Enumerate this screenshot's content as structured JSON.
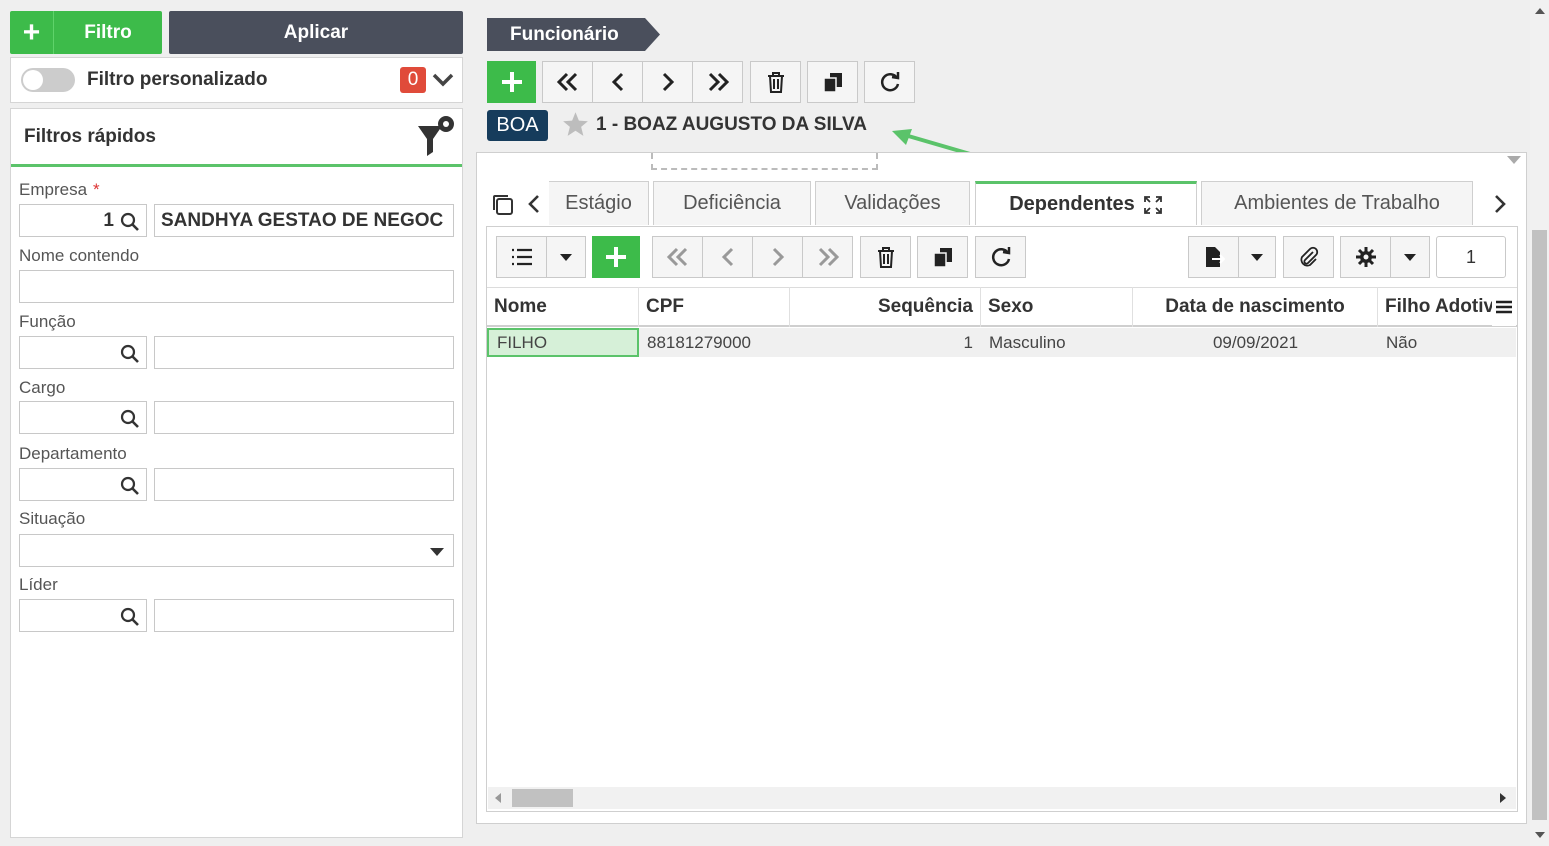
{
  "left": {
    "filtro_label": "Filtro",
    "aplicar_label": "Aplicar",
    "custom_filter_label": "Filtro personalizado",
    "custom_filter_count": "0",
    "quick_filters_title": "Filtros rápidos",
    "empresa": {
      "label": "Empresa",
      "required_mark": "*",
      "code": "1",
      "name": "SANDHYA GESTAO DE NEGOC"
    },
    "nome_contendo": {
      "label": "Nome contendo"
    },
    "funcao": {
      "label": "Função"
    },
    "cargo": {
      "label": "Cargo"
    },
    "departamento": {
      "label": "Departamento"
    },
    "situacao": {
      "label": "Situação"
    },
    "lider": {
      "label": "Líder"
    }
  },
  "right": {
    "breadcrumb": "Funcionário",
    "employee_badge": "BOA",
    "employee_name": "1 - BOAZ AUGUSTO DA SILVA",
    "tabs": [
      "Estágio",
      "Deficiência",
      "Validações",
      "Dependentes",
      "Ambientes de Trabalho"
    ],
    "page_number": "1",
    "table": {
      "headers": [
        "Nome",
        "CPF",
        "Sequência",
        "Sexo",
        "Data de nascimento",
        "Filho Adotiv"
      ],
      "rows": [
        [
          "FILHO",
          "88181279000",
          "1",
          "Masculino",
          "09/09/2021",
          "Não"
        ]
      ]
    }
  },
  "colors": {
    "green": "#3dbb4a",
    "dark": "#4a4f5c",
    "navy": "#163c5c",
    "red": "#e04b3a"
  }
}
